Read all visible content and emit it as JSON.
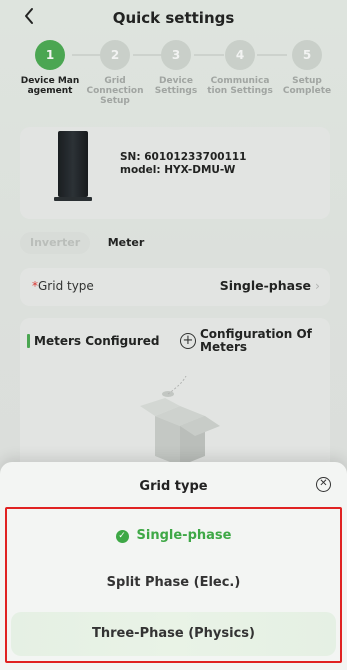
{
  "header": {
    "title": "Quick settings",
    "back_icon": "chevron-left-icon"
  },
  "steps": [
    {
      "number": "1",
      "label": "Device Man agement",
      "active": true
    },
    {
      "number": "2",
      "label": "Grid Connection Setup",
      "active": false
    },
    {
      "number": "3",
      "label": "Device Settings",
      "active": false
    },
    {
      "number": "4",
      "label": "Communica tion Settings",
      "active": false
    },
    {
      "number": "5",
      "label": "Setup Complete",
      "active": false
    }
  ],
  "device": {
    "sn": "SN: 60101233700111",
    "model": "model: HYX-DMU-W"
  },
  "tabs": {
    "inverter": "Inverter",
    "meter": "Meter"
  },
  "grid": {
    "required_mark": "*",
    "label": "Grid type",
    "value": "Single-phase"
  },
  "meters": {
    "title": "Meters Configured",
    "config_label": "Configuration Of Meters"
  },
  "sheet": {
    "title": "Grid type",
    "options": [
      {
        "label": "Single-phase",
        "selected": true
      },
      {
        "label": "Split Phase (Elec.)",
        "selected": false
      },
      {
        "label": "Three-Phase (Physics)",
        "selected": false
      }
    ]
  },
  "colors": {
    "accent": "#4eae55",
    "highlight_border": "#e02222"
  }
}
